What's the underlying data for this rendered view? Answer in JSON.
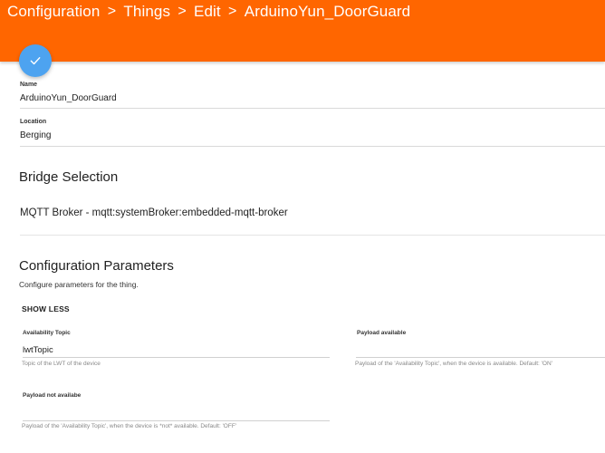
{
  "header": {
    "breadcrumbs": [
      "Configuration",
      "Things",
      "Edit",
      "ArduinoYun_DoorGuard"
    ],
    "separator": ">",
    "accent_color": "#ff6600"
  },
  "fab": {
    "icon": "checkmark-icon",
    "color": "#4da3f0"
  },
  "form": {
    "name": {
      "label": "Name",
      "value": "ArduinoYun_DoorGuard"
    },
    "location": {
      "label": "Location",
      "value": "Berging"
    }
  },
  "bridge": {
    "title": "Bridge Selection",
    "value": "MQTT Broker - mqtt:systemBroker:embedded-mqtt-broker"
  },
  "config": {
    "title": "Configuration Parameters",
    "subtitle": "Configure parameters for the thing.",
    "toggle_label": "SHOW LESS",
    "params": {
      "availability_topic": {
        "label": "Availability Topic",
        "value": "lwtTopic",
        "help": "Topic of the LWT of the device"
      },
      "payload_available": {
        "label": "Payload available",
        "value": "",
        "help": "Payload of the 'Availability Topic', when the device is available. Default: 'ON'"
      },
      "payload_not_available": {
        "label": "Payload not availabe",
        "value": "",
        "help": "Payload of the 'Availability Topic', when the device is *not* available. Default: 'OFF'"
      }
    }
  }
}
